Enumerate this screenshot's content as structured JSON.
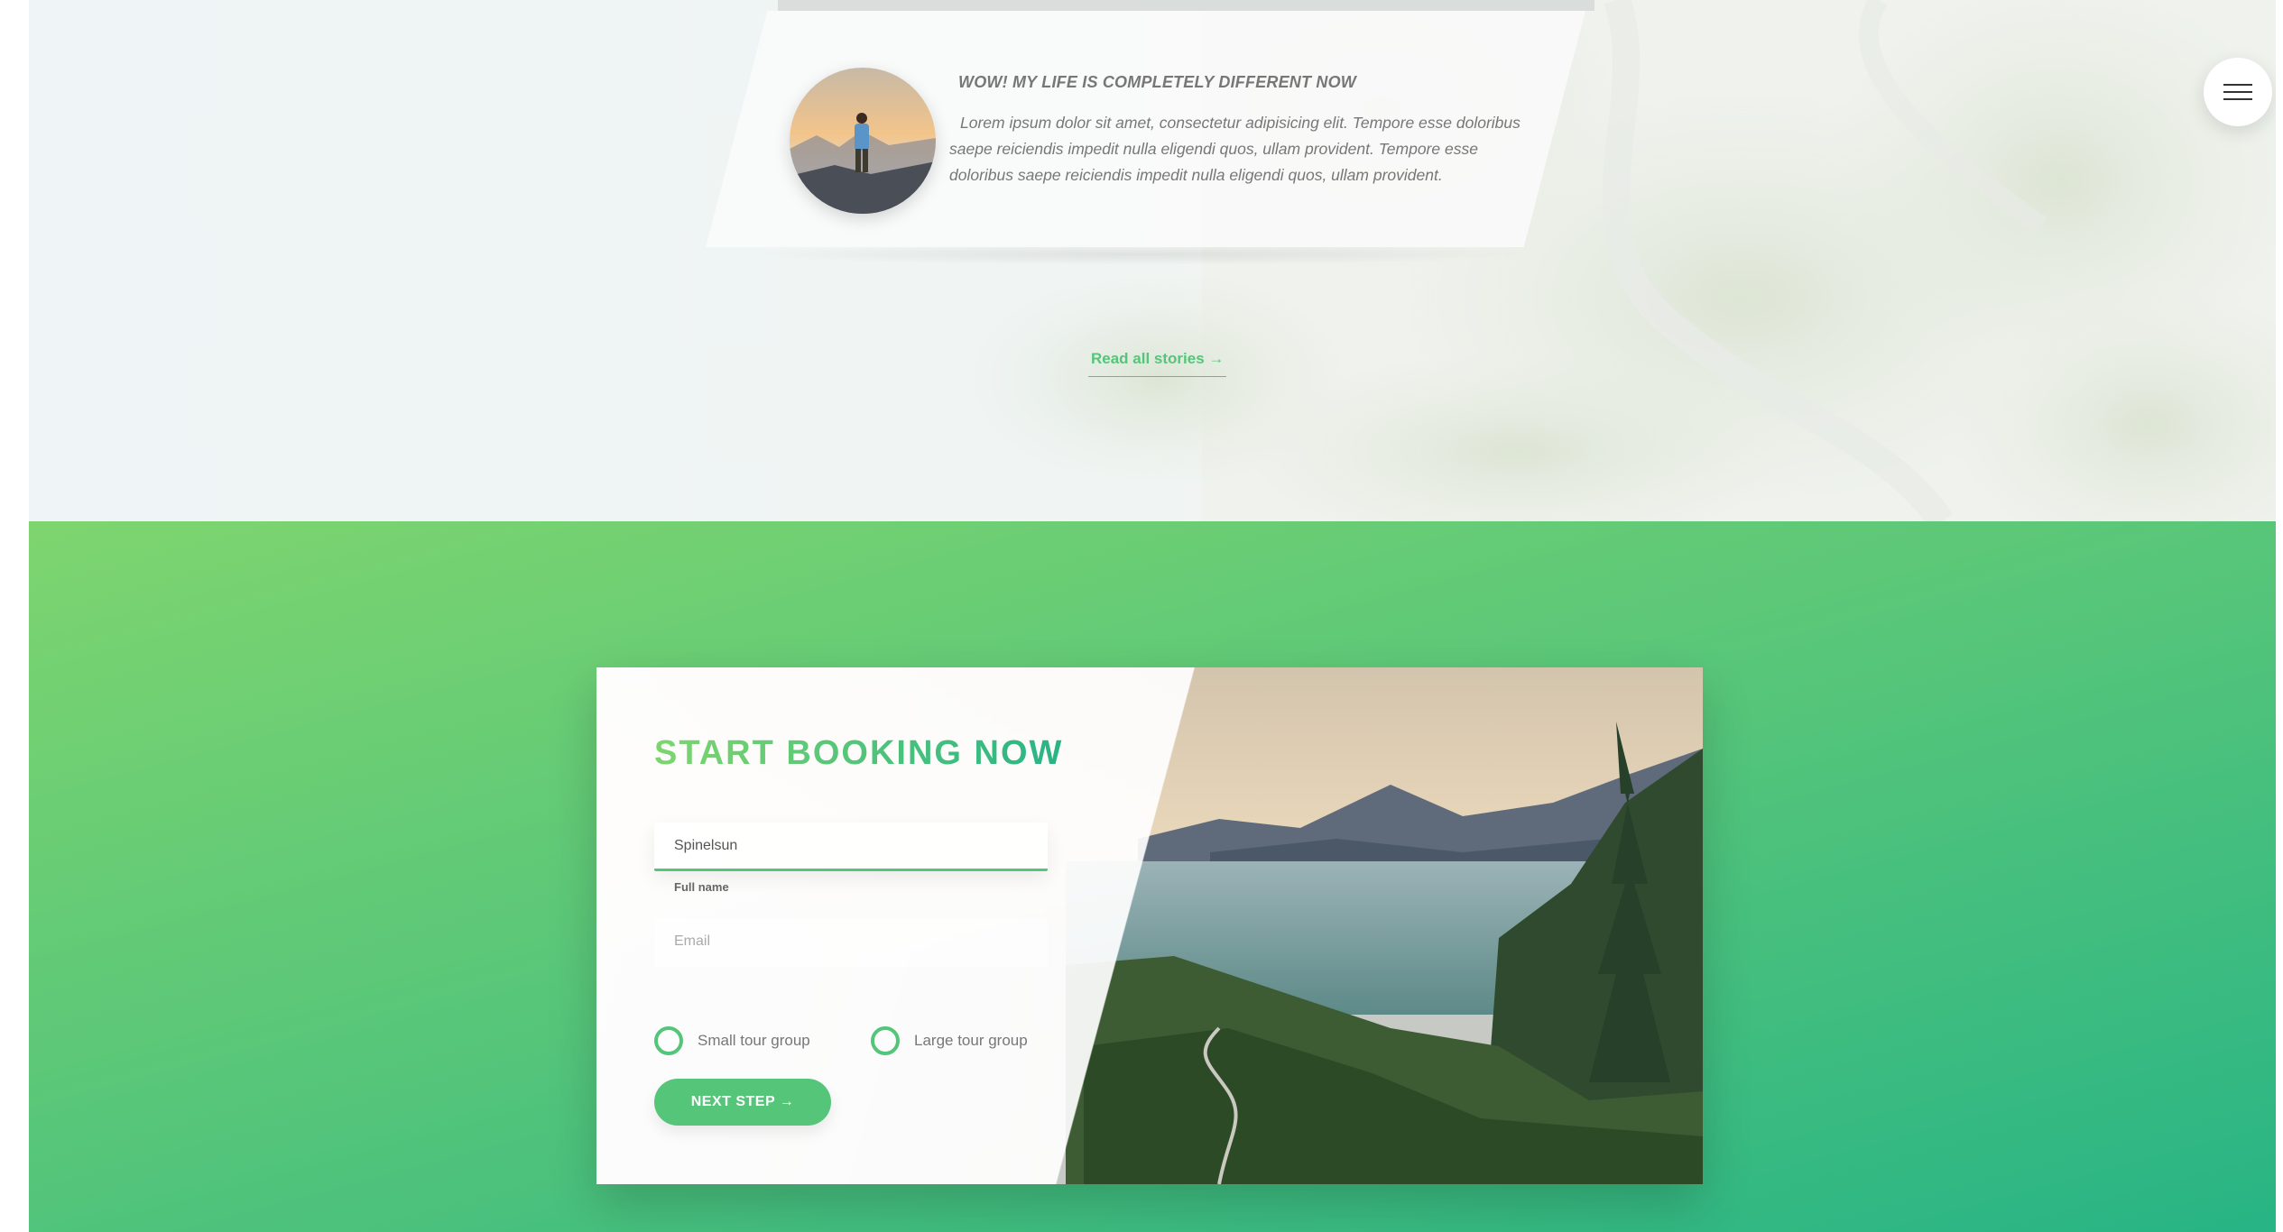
{
  "stories": {
    "card": {
      "title": "WOW! MY LIFE IS COMPLETELY DIFFERENT NOW",
      "text": "Lorem ipsum dolor sit amet, consectetur adipisicing elit. Tempore esse doloribus saepe reiciendis impedit nulla eligendi quos, ullam provident. Tempore esse doloribus saepe reiciendis impedit nulla eligendi quos, ullam provident."
    },
    "read_all_label": "Read all stories →"
  },
  "navigation": {
    "icon": "hamburger-menu-icon"
  },
  "booking": {
    "heading": "START BOOKING NOW",
    "fullname": {
      "value": "Spinelsun",
      "placeholder": "Full name",
      "label": "Full name"
    },
    "email": {
      "value": "",
      "placeholder": "Email",
      "label": "Email"
    },
    "size_options": [
      {
        "label": "Small tour group",
        "selected": false
      },
      {
        "label": "Large tour group",
        "selected": false
      }
    ],
    "next_button_label": "NEXT STEP →"
  },
  "colors": {
    "primary": "#55c57a",
    "primary_light": "#7ed56f",
    "primary_dark": "#28b485",
    "text": "#777777"
  }
}
